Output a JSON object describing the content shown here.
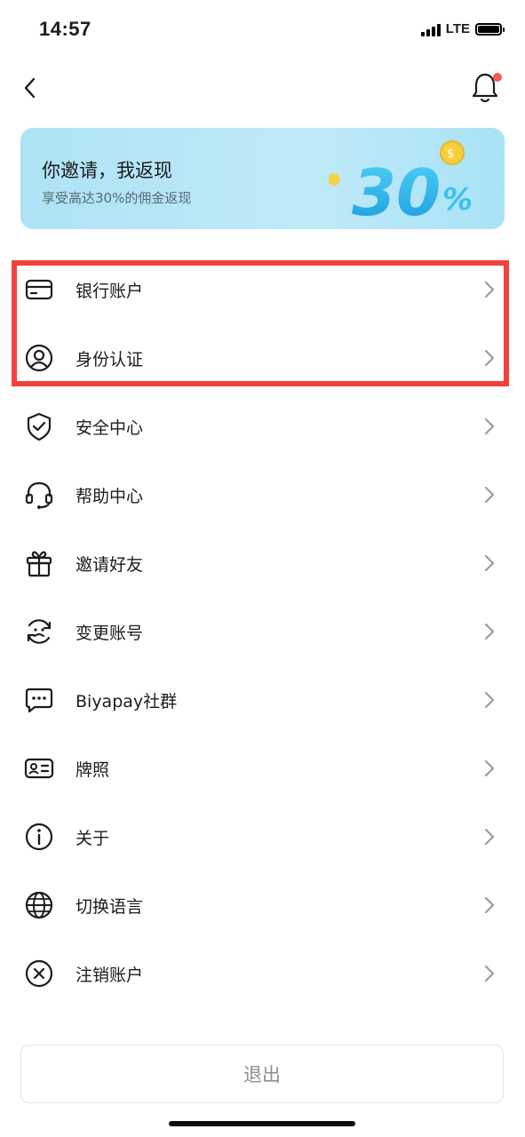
{
  "status_bar": {
    "time": "14:57",
    "network": "LTE"
  },
  "banner": {
    "title": "你邀请，我返现",
    "subtitle": "享受高达30%的佣金返现",
    "art_text": "30%"
  },
  "menu": [
    {
      "label": "银行账户",
      "icon": "bank-card-icon"
    },
    {
      "label": "身份认证",
      "icon": "user-circle-icon"
    },
    {
      "label": "安全中心",
      "icon": "shield-check-icon"
    },
    {
      "label": "帮助中心",
      "icon": "headset-icon"
    },
    {
      "label": "邀请好友",
      "icon": "gift-icon"
    },
    {
      "label": "变更账号",
      "icon": "switch-account-icon"
    },
    {
      "label": "Biyapay社群",
      "icon": "chat-bubble-icon"
    },
    {
      "label": "牌照",
      "icon": "id-card-icon"
    },
    {
      "label": "关于",
      "icon": "info-icon"
    },
    {
      "label": "切换语言",
      "icon": "globe-icon"
    },
    {
      "label": "注销账户",
      "icon": "close-circle-icon"
    }
  ],
  "logout_label": "退出",
  "colors": {
    "highlight": "#f2413b",
    "notification_dot": "#f05a5a",
    "banner": "#b4e5f6"
  }
}
